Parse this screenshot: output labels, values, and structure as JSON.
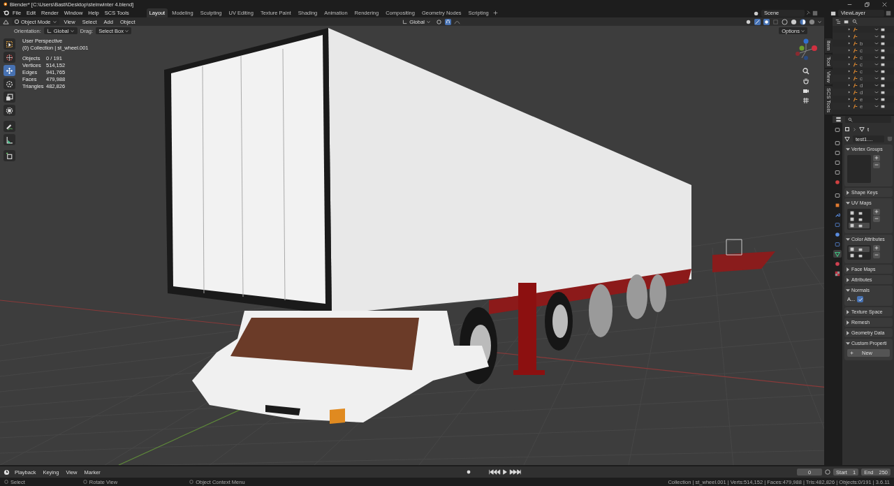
{
  "window": {
    "title": "Blender* [C:\\Users\\Basti\\Desktop\\steinwinter 4.blend]"
  },
  "menu": [
    "File",
    "Edit",
    "Render",
    "Window",
    "Help",
    "SCS Tools"
  ],
  "workspaces": [
    {
      "label": "Layout",
      "selected": true
    },
    {
      "label": "Modeling",
      "selected": false
    },
    {
      "label": "Sculpting",
      "selected": false
    },
    {
      "label": "UV Editing",
      "selected": false
    },
    {
      "label": "Texture Paint",
      "selected": false
    },
    {
      "label": "Shading",
      "selected": false
    },
    {
      "label": "Animation",
      "selected": false
    },
    {
      "label": "Rendering",
      "selected": false
    },
    {
      "label": "Compositing",
      "selected": false
    },
    {
      "label": "Geometry Nodes",
      "selected": false
    },
    {
      "label": "Scripting",
      "selected": false
    }
  ],
  "scene": "Scene",
  "view_layer": "ViewLayer",
  "header": {
    "mode": "Object Mode",
    "menus": [
      "View",
      "Select",
      "Add",
      "Object"
    ],
    "transform": "Global",
    "options": "Options"
  },
  "tool_settings": {
    "orientation_label": "Orientation:",
    "orientation": "Global",
    "drag_label": "Drag:",
    "drag": "Select Box"
  },
  "overlay": {
    "perspective": "User Perspective",
    "collection": "(0) Collection | st_wheel.001",
    "stats": [
      {
        "label": "Objects",
        "value": "0 / 191"
      },
      {
        "label": "Vertices",
        "value": "514,152"
      },
      {
        "label": "Edges",
        "value": "941,765"
      },
      {
        "label": "Faces",
        "value": "479,988"
      },
      {
        "label": "Triangles",
        "value": "482,826"
      }
    ]
  },
  "tools": [
    {
      "kind": "select",
      "selected": false
    },
    {
      "kind": "cursor",
      "selected": false
    },
    {
      "kind": "move",
      "selected": true
    },
    {
      "kind": "rotate",
      "selected": false
    },
    {
      "kind": "scale",
      "selected": false
    },
    {
      "kind": "transform",
      "selected": false
    },
    {
      "kind": "annotate",
      "selected": false
    },
    {
      "kind": "measure",
      "selected": false
    },
    {
      "kind": "add-cube",
      "selected": false
    }
  ],
  "n_tabs": [
    "Item",
    "Tool",
    "View",
    "SCS Tools"
  ],
  "outliner": [
    {
      "kind": "armature"
    },
    {
      "kind": "armature"
    },
    {
      "kind": "armature",
      "label": "b"
    },
    {
      "kind": "armature",
      "label": "c"
    },
    {
      "kind": "armature",
      "label": "c"
    },
    {
      "kind": "armature",
      "label": "c"
    },
    {
      "kind": "armature",
      "label": "c"
    },
    {
      "kind": "armature",
      "label": "c"
    },
    {
      "kind": "armature",
      "label": "d"
    },
    {
      "kind": "armature",
      "label": "d"
    },
    {
      "kind": "armature",
      "label": "e"
    },
    {
      "kind": "armature",
      "label": "e"
    }
  ],
  "properties": {
    "object": "t",
    "mesh": "test1....",
    "tabs": [
      {
        "kind": "tool",
        "selected": false
      },
      {
        "kind": "render",
        "selected": false
      },
      {
        "kind": "output",
        "selected": false
      },
      {
        "kind": "view-layer",
        "selected": false
      },
      {
        "kind": "scene",
        "selected": false
      },
      {
        "kind": "world",
        "selected": false
      },
      {
        "kind": "collection",
        "selected": false
      },
      {
        "kind": "object",
        "selected": false
      },
      {
        "kind": "modifier",
        "selected": false
      },
      {
        "kind": "particles",
        "selected": false
      },
      {
        "kind": "physics",
        "selected": false
      },
      {
        "kind": "constraints",
        "selected": false
      },
      {
        "kind": "data",
        "selected": true
      },
      {
        "kind": "material",
        "selected": false
      },
      {
        "kind": "texture",
        "selected": false
      }
    ],
    "panels": [
      {
        "title": "Vertex Groups",
        "expanded": true,
        "kind": "list"
      },
      {
        "title": "Shape Keys",
        "expanded": false
      },
      {
        "title": "UV Maps",
        "expanded": true,
        "kind": "list",
        "rows": [
          {
            "selected": false
          },
          {
            "selected": false
          },
          {
            "selected": true
          }
        ]
      },
      {
        "title": "Color Attributes",
        "expanded": true,
        "kind": "list",
        "rows": [
          {
            "selected": true
          },
          {
            "selected": false
          }
        ]
      },
      {
        "title": "Face Maps",
        "expanded": false
      },
      {
        "title": "Attributes",
        "expanded": false
      },
      {
        "title": "Normals",
        "expanded": true,
        "kind": "checkbox",
        "label": "A...",
        "checked": true
      },
      {
        "title": "Texture Space",
        "expanded": false
      },
      {
        "title": "Remesh",
        "expanded": false
      },
      {
        "title": "Geometry Data",
        "expanded": false
      },
      {
        "title": "Custom Properti",
        "expanded": true,
        "kind": "button",
        "label": "New"
      }
    ]
  },
  "timeline": {
    "menus": [
      "Playback",
      "Keying",
      "View",
      "Marker"
    ],
    "frame": "0",
    "start_label": "Start",
    "start": "1",
    "end_label": "End",
    "end": "250"
  },
  "status": {
    "hints": [
      "Select",
      "Rotate View",
      "Object Context Menu"
    ],
    "info": "Collection | st_wheel.001 | Verts:514,152 | Faces:479,988 | Tris:482,826 | Objects:0/191 | 3.6.11"
  }
}
